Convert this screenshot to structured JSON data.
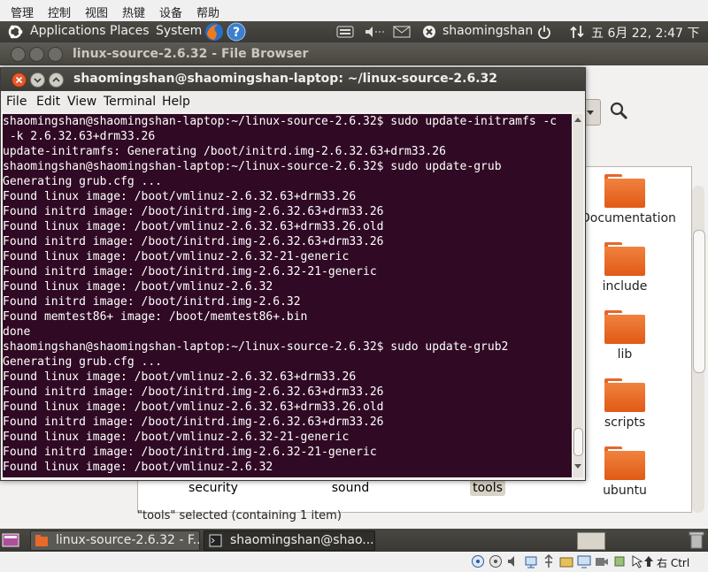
{
  "host_menu": [
    "管理",
    "控制",
    "视图",
    "热键",
    "设备",
    "帮助"
  ],
  "top_panel": {
    "applications": "Applications",
    "places": "Places",
    "system": "System",
    "user": "shaomingshan",
    "clock": "五 6月 22, 2:47 下"
  },
  "file_browser": {
    "title": "linux-source-2.6.32 - File Browser",
    "folders_right": [
      "Documentation",
      "include",
      "lib",
      "scripts",
      "ubuntu"
    ],
    "folders_bottom": [
      "security",
      "sound",
      "tools"
    ],
    "status": "\"tools\" selected (containing 1 item)"
  },
  "terminal": {
    "title": "shaomingshan@shaomingshan-laptop: ~/linux-source-2.6.32",
    "menu": [
      "File",
      "Edit",
      "View",
      "Terminal",
      "Help"
    ],
    "lines": [
      "shaomingshan@shaomingshan-laptop:~/linux-source-2.6.32$ sudo update-initramfs -c",
      " -k 2.6.32.63+drm33.26",
      "update-initramfs: Generating /boot/initrd.img-2.6.32.63+drm33.26",
      "shaomingshan@shaomingshan-laptop:~/linux-source-2.6.32$ sudo update-grub",
      "Generating grub.cfg ...",
      "Found linux image: /boot/vmlinuz-2.6.32.63+drm33.26",
      "Found initrd image: /boot/initrd.img-2.6.32.63+drm33.26",
      "Found linux image: /boot/vmlinuz-2.6.32.63+drm33.26.old",
      "Found initrd image: /boot/initrd.img-2.6.32.63+drm33.26",
      "Found linux image: /boot/vmlinuz-2.6.32-21-generic",
      "Found initrd image: /boot/initrd.img-2.6.32-21-generic",
      "Found linux image: /boot/vmlinuz-2.6.32",
      "Found initrd image: /boot/initrd.img-2.6.32",
      "Found memtest86+ image: /boot/memtest86+.bin",
      "done",
      "shaomingshan@shaomingshan-laptop:~/linux-source-2.6.32$ sudo update-grub2",
      "Generating grub.cfg ...",
      "Found linux image: /boot/vmlinuz-2.6.32.63+drm33.26",
      "Found initrd image: /boot/initrd.img-2.6.32.63+drm33.26",
      "Found linux image: /boot/vmlinuz-2.6.32.63+drm33.26.old",
      "Found initrd image: /boot/initrd.img-2.6.32.63+drm33.26",
      "Found linux image: /boot/vmlinuz-2.6.32-21-generic",
      "Found initrd image: /boot/initrd.img-2.6.32-21-generic",
      "Found linux image: /boot/vmlinuz-2.6.32"
    ]
  },
  "taskbar": {
    "items": [
      "linux-source-2.6.32 - F...",
      "shaomingshan@shao..."
    ]
  },
  "host_status": {
    "key": "右 Ctrl"
  },
  "colors": {
    "terminal_bg": "#300a24",
    "panel": "#3c3b37",
    "folder": "#e8692a"
  }
}
